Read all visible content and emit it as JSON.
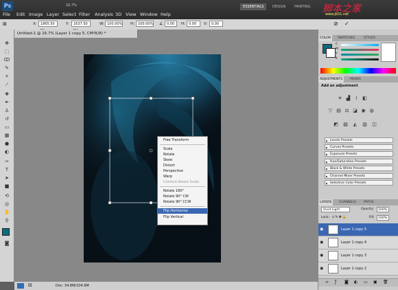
{
  "app": {
    "logo": "Ps",
    "zoom": "16.7%"
  },
  "menu": [
    "File",
    "Edit",
    "Image",
    "Layer",
    "Select",
    "Filter",
    "Analysis",
    "3D",
    "View",
    "Window",
    "Help"
  ],
  "workspaces": [
    "ESSENTIALS",
    "DESIGN",
    "PAINTING"
  ],
  "watermark": {
    "text": "脚本之家",
    "url": "www.jb51.net"
  },
  "options": {
    "x_label": "X:",
    "x_value": "1865.50 px",
    "y_label": "Y:",
    "y_value": "1637.50 px",
    "w_label": "W:",
    "w_value": "100.00%",
    "h_label": "H:",
    "h_value": "100.00%",
    "angle_value": "0.00",
    "skew_h_label": "H:",
    "skew_h_value": "0.00",
    "skew_v_label": "V:",
    "skew_v_value": "0.00",
    "cancel_icon": "cancel-icon",
    "commit_icon": "commit-icon"
  },
  "document": {
    "tab_title": "Untitled-1 @ 16.7% (Layer 1 copy 5, CMYK/8) *",
    "status": "Doc: 34.8M/104.6M"
  },
  "context_menu": {
    "items": [
      {
        "label": "Free Transform",
        "state": "normal"
      },
      {
        "label": "Scale",
        "state": "normal"
      },
      {
        "label": "Rotate",
        "state": "normal"
      },
      {
        "label": "Skew",
        "state": "normal"
      },
      {
        "label": "Distort",
        "state": "normal"
      },
      {
        "label": "Perspective",
        "state": "normal"
      },
      {
        "label": "Warp",
        "state": "normal"
      },
      {
        "label": "Content-Aware Scale",
        "state": "disabled"
      },
      {
        "label": "Rotate 180°",
        "state": "normal"
      },
      {
        "label": "Rotate 90° CW",
        "state": "normal"
      },
      {
        "label": "Rotate 90° CCW",
        "state": "normal"
      },
      {
        "label": "Flip Horizontal",
        "state": "highlighted"
      },
      {
        "label": "Flip Vertical",
        "state": "normal"
      }
    ]
  },
  "color_panel": {
    "tabs": [
      "COLOR",
      "SWATCHES",
      "STYLES"
    ],
    "foreground": "#0d6b7a",
    "background": "#ffffff",
    "channels": [
      "C",
      "M",
      "Y",
      "K"
    ]
  },
  "adjustments_panel": {
    "tabs": [
      "ADJUSTMENTS",
      "MASKS"
    ],
    "heading": "Add an adjustment",
    "presets": [
      "Levels Presets",
      "Curves Presets",
      "Exposure Presets",
      "Hue/Saturation Presets",
      "Black & White Presets",
      "Channel Mixer Presets",
      "Selective Color Presets"
    ]
  },
  "layers_panel": {
    "tabs": [
      "LAYERS",
      "CHANNELS",
      "PATHS"
    ],
    "blend_mode": "Vivid Light",
    "opacity_label": "Opacity:",
    "opacity_value": "100%",
    "lock_label": "Lock:",
    "fill_label": "Fill:",
    "fill_value": "100%",
    "layers": [
      {
        "name": "Layer 1 copy 5",
        "selected": true
      },
      {
        "name": "Layer 1 copy 4",
        "selected": false
      },
      {
        "name": "Layer 1 copy 3",
        "selected": false
      },
      {
        "name": "Layer 1 copy 2",
        "selected": false
      }
    ]
  },
  "colors": {
    "selection": "#3a67b3",
    "canvas_accent": "#1c6f8f"
  }
}
